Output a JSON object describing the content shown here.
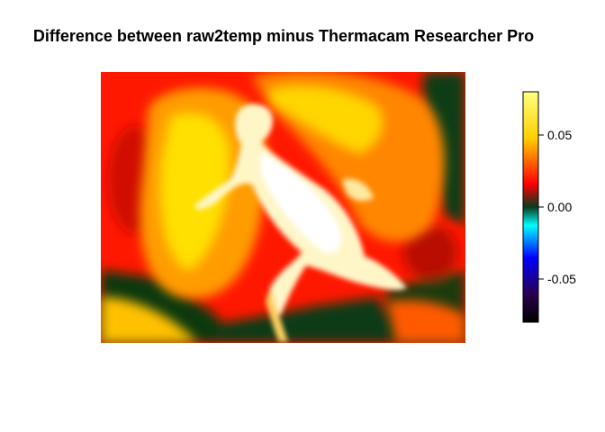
{
  "chart_data": {
    "type": "heatmap",
    "title": "Difference between raw2temp minus Thermacam Researcher Pro",
    "xlabel": "",
    "ylabel": "",
    "colorbar": {
      "range": [
        -0.08,
        0.08
      ],
      "ticks": [
        -0.05,
        0.0,
        0.05
      ],
      "tick_labels": [
        "-0.05",
        "0.00",
        "0.05"
      ],
      "colors": [
        "#000000",
        "#2a004f",
        "#0000ff",
        "#00ffff",
        "#0a3a1e",
        "#ff0000",
        "#ffff00",
        "#ffffff"
      ]
    },
    "colors": {
      "background_dark": "#0b3a12",
      "hot_red": "#ff1400",
      "warm_orange": "#ff8c00",
      "warm_yellow": "#ffe600",
      "hottest": "#fffef0"
    },
    "grid": false,
    "legend": "right"
  }
}
